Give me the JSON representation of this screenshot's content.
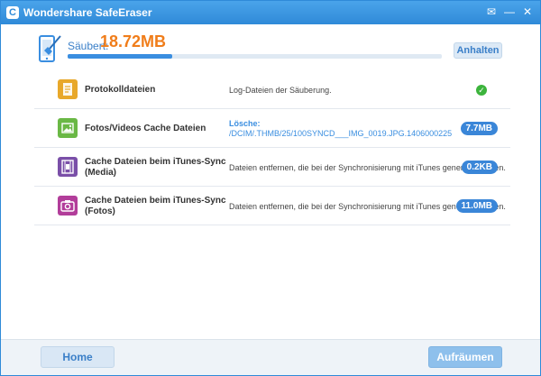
{
  "window": {
    "title": "Wondershare SafeEraser",
    "logo_letter": "C",
    "controls": {
      "feedback": "✉",
      "minimize": "—",
      "close": "✕"
    }
  },
  "summary": {
    "label": "Säubert:",
    "size": "18.72MB",
    "progress_percent": 28,
    "pause_label": "Anhalten"
  },
  "rows": [
    {
      "title": [
        "Protokolldateien"
      ],
      "desc": [
        "Log-Dateien der Säuberung."
      ],
      "status": "done",
      "icon": "document-icon",
      "icon_color": "#e8a82a"
    },
    {
      "title": [
        "Fotos/Videos Cache Dateien"
      ],
      "desc": [
        "Lösche:",
        "/DCIM/.THMB/25/100SYNCD___IMG_0019.JPG.1406000225"
      ],
      "size": "7.7MB",
      "icon": "photo-icon",
      "icon_color": "#6ab845"
    },
    {
      "title": [
        "Cache Dateien beim iTunes-Sync",
        "(Media)"
      ],
      "desc": [
        "Dateien entfernen, die bei der Synchronisierung mit iTunes generiert wurden."
      ],
      "size": "0.2KB",
      "icon": "film-icon",
      "icon_color": "#7a4fa8"
    },
    {
      "title": [
        "Cache Dateien beim iTunes-Sync",
        "(Fotos)"
      ],
      "desc": [
        "Dateien entfernen, die bei der Synchronisierung mit iTunes generiert wurden."
      ],
      "size": "11.0MB",
      "icon": "camera-icon",
      "icon_color": "#b23d9a"
    }
  ],
  "footer": {
    "home_label": "Home",
    "clean_label": "Aufräumen"
  }
}
